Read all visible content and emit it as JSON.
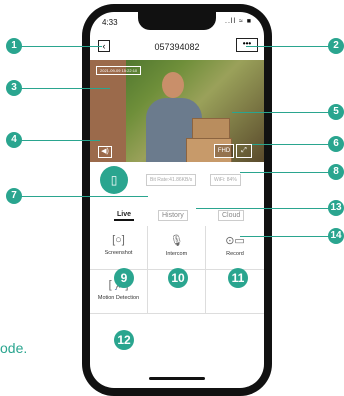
{
  "status": {
    "time": "4:33",
    "icons": "..ll ≈ ■"
  },
  "header": {
    "title": "057394082",
    "back_icon": "chevron-left-icon",
    "more_label": "•••"
  },
  "video": {
    "fhd_label": "FHD",
    "fullscreen_icon": "expand-icon",
    "mute_icon": "speaker-icon",
    "watermark": "2021-09-09 15:22:10"
  },
  "info": {
    "bitrate": "Bit Rate:41.86KB/s",
    "wifi": "WiFi: 84%"
  },
  "tabs": [
    {
      "label": "Live"
    },
    {
      "label": "History"
    },
    {
      "label": "Cloud"
    }
  ],
  "functions": [
    {
      "label": "Screenshot",
      "icon": "screenshot-icon"
    },
    {
      "label": "Intercom",
      "icon": "microphone-icon"
    },
    {
      "label": "Record",
      "icon": "video-camera-icon"
    },
    {
      "label": "Motion Detection",
      "icon": "running-person-icon"
    }
  ],
  "callouts": [
    "1",
    "2",
    "3",
    "4",
    "5",
    "6",
    "7",
    "8",
    "9",
    "10",
    "11",
    "12",
    "13",
    "14"
  ],
  "bottom_text": "ode."
}
